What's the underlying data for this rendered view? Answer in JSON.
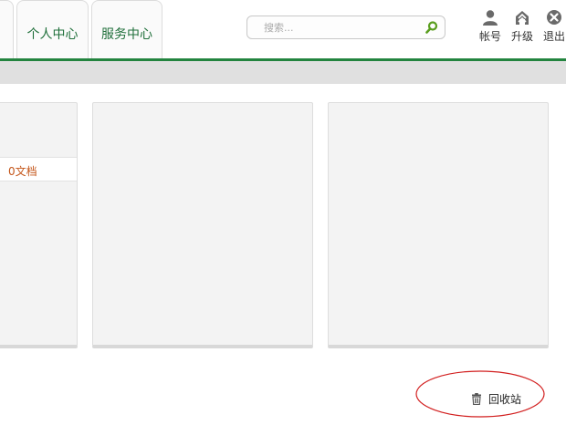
{
  "nav": {
    "tabs": [
      {
        "label": ""
      },
      {
        "label": "个人中心"
      },
      {
        "label": "服务中心"
      }
    ]
  },
  "search": {
    "placeholder": "搜索..."
  },
  "header_actions": {
    "account": {
      "label": "帐号",
      "icon": "user-icon"
    },
    "upgrade": {
      "label": "升级",
      "icon": "upgrade-icon"
    },
    "logout": {
      "label": "退出",
      "icon": "close-circle-icon"
    }
  },
  "panels": {
    "first": {
      "doc_count": "0文档"
    }
  },
  "recycle_bin": {
    "label": "回收站",
    "icon": "trash-icon"
  },
  "colors": {
    "brand_green": "#23843f",
    "tab_text": "#1f6f3a",
    "doc_count": "#c4561a",
    "annotation": "#d21f1f"
  }
}
